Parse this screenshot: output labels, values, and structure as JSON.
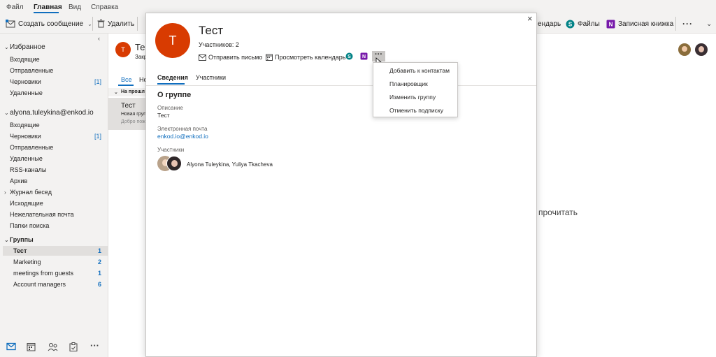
{
  "menu": {
    "tabs": [
      "Файл",
      "Главная",
      "Вид",
      "Справка"
    ],
    "active_index": 1
  },
  "ribbon": {
    "new_message": "Создать сообщение",
    "delete": "Удалить",
    "calendar_partial": "ендарь",
    "files": "Файлы",
    "notebook": "Записная книжка",
    "more": "···"
  },
  "folders": {
    "favorites": {
      "title": "Избранное",
      "items": [
        {
          "label": "Входящие",
          "count": ""
        },
        {
          "label": "Отправленные",
          "count": ""
        },
        {
          "label": "Черновики",
          "count": "[1]"
        },
        {
          "label": "Удаленные",
          "count": ""
        }
      ]
    },
    "account": {
      "title": "alyona.tuleykina@enkod.io",
      "items": [
        {
          "label": "Входящие",
          "count": ""
        },
        {
          "label": "Черновики",
          "count": "[1]"
        },
        {
          "label": "Отправленные",
          "count": ""
        },
        {
          "label": "Удаленные",
          "count": ""
        },
        {
          "label": "RSS-каналы",
          "count": ""
        },
        {
          "label": "Архив",
          "count": ""
        },
        {
          "label": "Журнал бесед",
          "count": ""
        },
        {
          "label": "Исходящие",
          "count": ""
        },
        {
          "label": "Нежелательная почта",
          "count": ""
        },
        {
          "label": "Папки поиска",
          "count": ""
        }
      ]
    },
    "groups": {
      "title": "Группы",
      "items": [
        {
          "label": "Тест",
          "count": "1"
        },
        {
          "label": "Marketing",
          "count": "2"
        },
        {
          "label": "meetings from guests",
          "count": "1"
        },
        {
          "label": "Account managers",
          "count": "6"
        }
      ]
    }
  },
  "mail_list": {
    "header_initial": "Т",
    "header_title": "Тес",
    "header_sub": "Закр",
    "filter_all": "Все",
    "filter_other": "Не",
    "section": "На прошл",
    "item_title": "Тест",
    "item_line1": "Новая груп",
    "item_line2": "Добро пож"
  },
  "reading": {
    "hint": "прочитать"
  },
  "dialog": {
    "initial": "Т",
    "title": "Тест",
    "members_count": "Участников: 2",
    "actions": {
      "send_mail": "Отправить письмо",
      "view_calendar": "Просмотреть календарь"
    },
    "tabs": [
      "Сведения",
      "Участники"
    ],
    "about_title": "О группе",
    "description_label": "Описание",
    "description_value": "Тест",
    "email_label": "Электронная почта",
    "email_value": "enkod.io@enkod.io",
    "members_label": "Участники",
    "members_value": "Alyona Tuleykina, Yuliya Tkacheva"
  },
  "dropdown": {
    "items": [
      "Добавить к контактам",
      "Планировщик",
      "Изменить группу",
      "Отменить подписку"
    ]
  },
  "colors": {
    "accent": "#106ebe",
    "avatar": "#d83b01",
    "onenote": "#7719aa",
    "sharepoint": "#038387"
  }
}
